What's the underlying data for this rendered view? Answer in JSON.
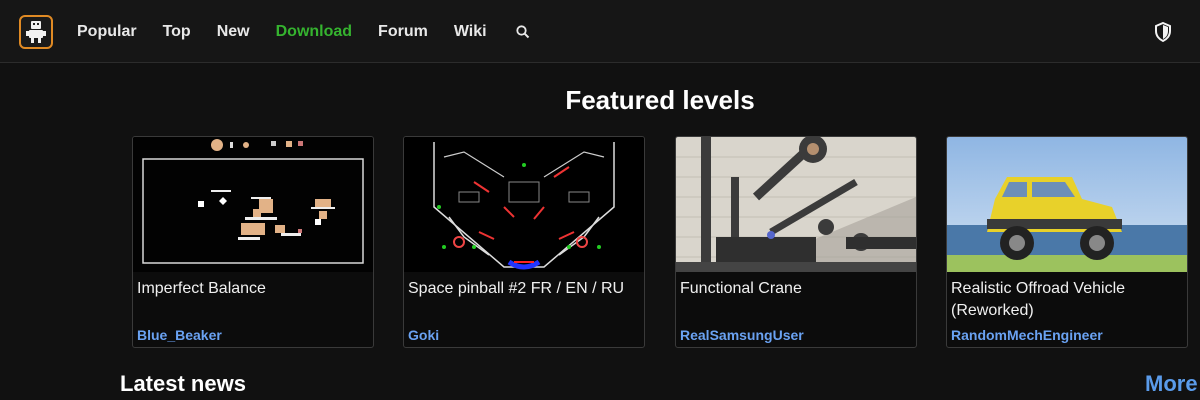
{
  "nav": {
    "items": [
      {
        "label": "Popular",
        "active": false
      },
      {
        "label": "Top",
        "active": false
      },
      {
        "label": "New",
        "active": false
      },
      {
        "label": "Download",
        "active": true
      },
      {
        "label": "Forum",
        "active": false
      },
      {
        "label": "Wiki",
        "active": false
      }
    ],
    "icons": {
      "logo": "robot-logo-icon",
      "search": "search-icon",
      "privacy": "shield-icon"
    }
  },
  "featured": {
    "title": "Featured levels",
    "cards": [
      {
        "title": "Imperfect Balance",
        "author": "Blue_Beaker"
      },
      {
        "title": "Space pinball #2 FR / EN / RU",
        "author": "Goki"
      },
      {
        "title": "Functional Crane",
        "author": "RealSamsungUser"
      },
      {
        "title": "Realistic Offroad Vehicle (Reworked)",
        "author": "RandomMechEngineer"
      }
    ]
  },
  "news": {
    "title": "Latest news",
    "more_label": "More"
  },
  "colors": {
    "accent_active": "#35b32f",
    "link": "#6aa2f2",
    "logo_border": "#e08a24",
    "background": "#111111"
  }
}
